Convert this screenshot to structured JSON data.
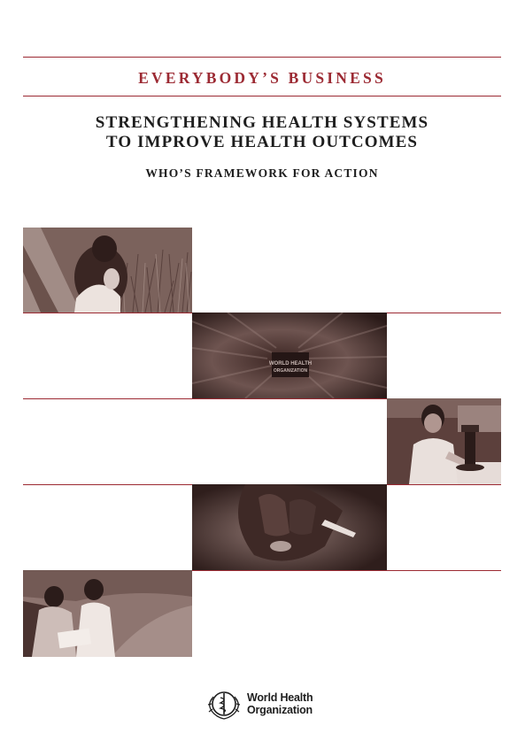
{
  "header": {
    "series": "EVERYBODY’S BUSINESS",
    "title_line1": "STRENGTHENING HEALTH SYSTEMS",
    "title_line2": "TO IMPROVE HEALTH OUTCOMES",
    "subtitle": "WHO’S FRAMEWORK FOR ACTION"
  },
  "colors": {
    "accent": "#9c2a33",
    "text": "#1e1e1e",
    "photo_tint": "#5a3a36"
  },
  "photos": [
    {
      "name": "children-in-rice-field-photo",
      "subject": "children in field"
    },
    {
      "name": "motion-blur-crowd-photo",
      "subject": "blurred crowd",
      "printed_text": "WORLD HEALTH ORGANIZATION"
    },
    {
      "name": "lab-technician-microscope-photo",
      "subject": "technician at microscope"
    },
    {
      "name": "gloved-hand-pipette-photo",
      "subject": "gloved hand with pipette"
    },
    {
      "name": "health-workers-clipboard-photo",
      "subject": "health workers with clipboard"
    }
  ],
  "publisher": {
    "line1": "World Health",
    "line2": "Organization",
    "icon": "who-emblem-icon"
  }
}
